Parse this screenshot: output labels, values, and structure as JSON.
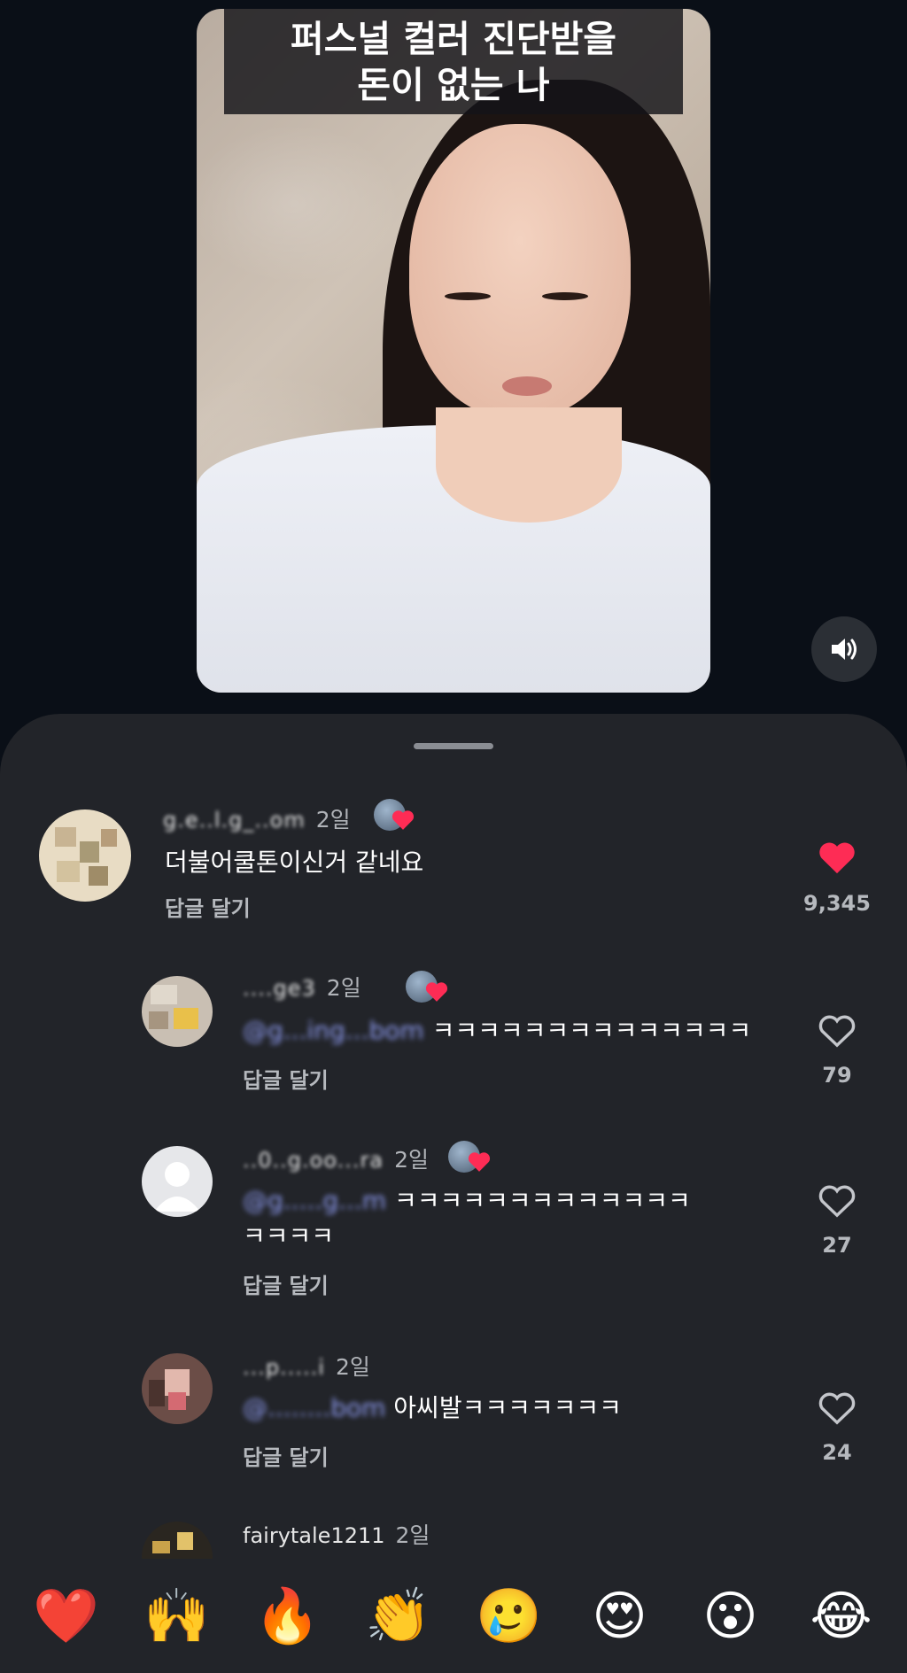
{
  "video": {
    "caption_line1": "퍼스널 컬러 진단받을",
    "caption_line2": "돈이 없는 나"
  },
  "comments": [
    {
      "username": "g.e..l.g_..om",
      "date": "2일",
      "text": "더불어쿨톤이신거 같네요",
      "reply_label": "답글 달기",
      "likes": "9,345",
      "liked": true,
      "creator_liked": true
    },
    {
      "username": "....ge3",
      "date": "2일",
      "mention": "@g...ing...bom",
      "text": "ㅋㅋㅋㅋㅋㅋㅋㅋㅋㅋㅋㅋㅋㅋ",
      "reply_label": "답글 달기",
      "likes": "79",
      "liked": false,
      "creator_liked": true
    },
    {
      "username": "..0..g.oo...ra",
      "date": "2일",
      "mention": "@g.....g...m",
      "text": "ㅋㅋㅋㅋㅋㅋㅋㅋㅋㅋㅋㅋㅋ",
      "text2": "ㅋㅋㅋㅋ",
      "reply_label": "답글 달기",
      "likes": "27",
      "liked": false,
      "creator_liked": true
    },
    {
      "username": "...p.....i",
      "date": "2일",
      "mention": "@........bom",
      "text": "아씨발ㅋㅋㅋㅋㅋㅋㅋ",
      "reply_label": "답글 달기",
      "likes": "24",
      "liked": false,
      "creator_liked": false
    },
    {
      "username": "fairytale1211",
      "date": "2일"
    }
  ],
  "emoji_bar": [
    "❤️",
    "🙌",
    "🔥",
    "👏",
    "🥲",
    "😍",
    "😮",
    "😂"
  ],
  "colors": {
    "background": "#0a0f17",
    "sheet": "#222429",
    "like_red": "#fe2c55",
    "mention": "#8f9cf2"
  }
}
